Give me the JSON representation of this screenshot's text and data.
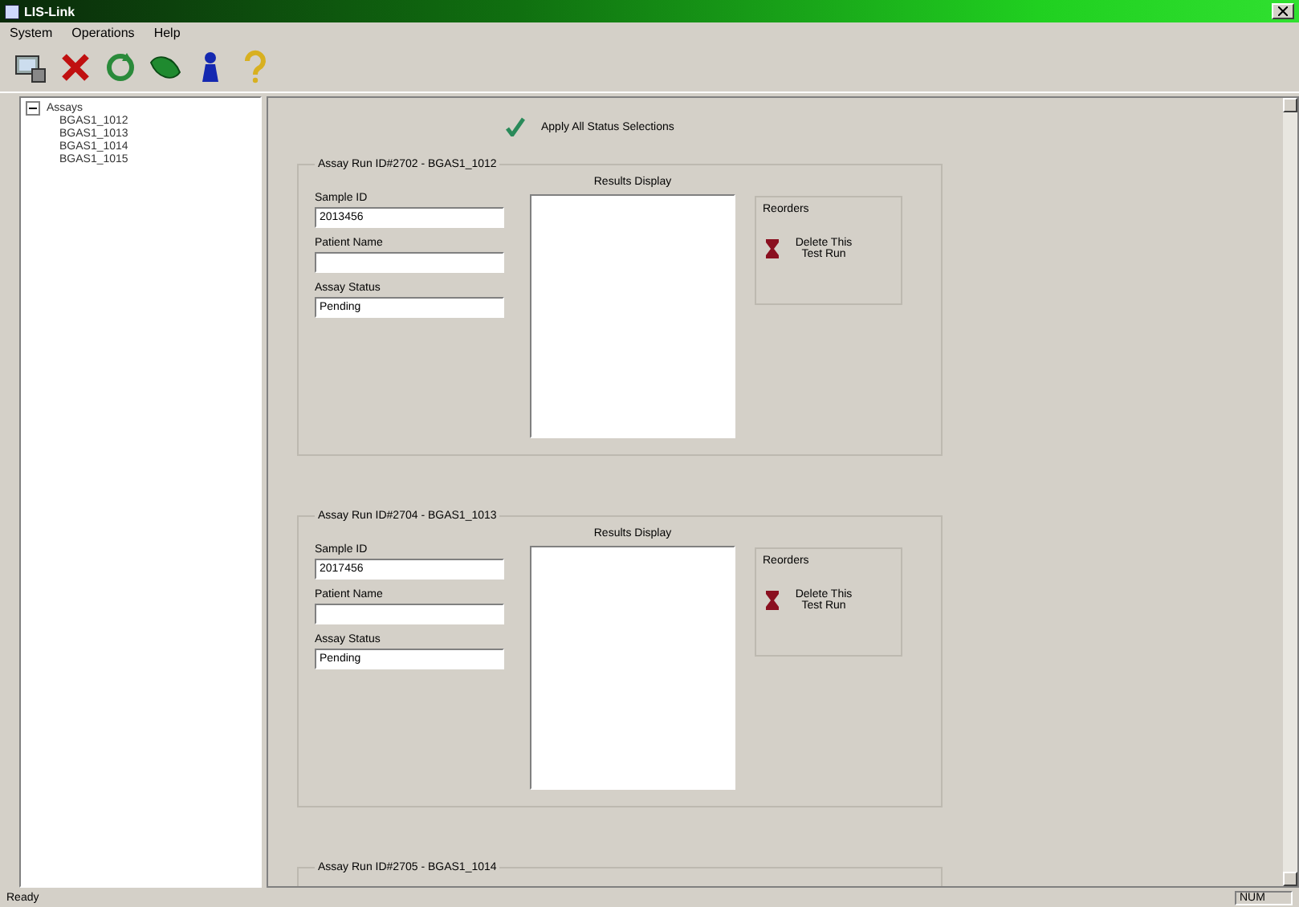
{
  "window": {
    "title": "LIS-Link"
  },
  "menu": [
    "System",
    "Operations",
    "Help"
  ],
  "tree": {
    "label": "Assays",
    "expanded": true,
    "children": [
      {
        "label": "BGAS1_1012"
      },
      {
        "label": "BGAS1_1013"
      },
      {
        "label": "BGAS1_1014"
      },
      {
        "label": "BGAS1_1015"
      }
    ]
  },
  "apply_all": {
    "label": "Apply All Status Selections"
  },
  "runs": [
    {
      "title": "Assay Run ID#2702 - BGAS1_1012",
      "sample_id_label": "Sample ID",
      "sample_id": "2013456",
      "patient_label": "Patient Name",
      "status_label": "Assay Status",
      "status": "Pending",
      "results_label": "Results Display",
      "reorders_label": "Reorders",
      "reorder_button": "Delete This Test Run"
    },
    {
      "title": "Assay Run ID#2704 - BGAS1_1013",
      "sample_id_label": "Sample ID",
      "sample_id": "2017456",
      "patient_label": "Patient Name",
      "status_label": "Assay Status",
      "status": "Pending",
      "results_label": "Results Display",
      "reorders_label": "Reorders",
      "reorder_button": "Delete This Test Run"
    },
    {
      "title": "Assay Run ID#2705 - BGAS1_1014"
    }
  ],
  "status_bar": [
    "Ready",
    "NUM"
  ]
}
